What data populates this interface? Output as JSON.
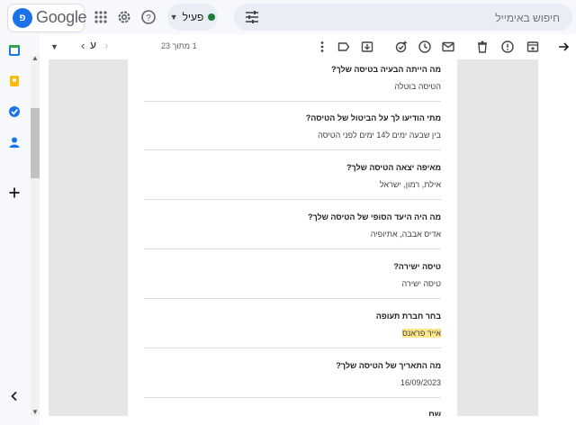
{
  "header": {
    "logo_initial": "פ",
    "logo_text": "Google",
    "status_label": "פעיל",
    "status_color": "#188038",
    "search_placeholder": "חיפוש באימייל",
    "icons": [
      "apps-grid-icon",
      "settings-gear-icon",
      "help-icon",
      "tune-icon"
    ]
  },
  "toolbar": {
    "pager_text": "1 מתוך 23",
    "lang_label": "ע",
    "icons": [
      "back-arrow-icon",
      "archive-icon",
      "report-spam-icon",
      "delete-icon",
      "mark-unread-icon",
      "snooze-icon",
      "add-task-icon",
      "move-to-icon",
      "label-icon",
      "more-vert-icon"
    ]
  },
  "rail": {
    "icons": [
      "calendar-icon",
      "keep-icon",
      "tasks-icon",
      "contacts-icon",
      "add-icon",
      "collapse-icon"
    ]
  },
  "form": {
    "items": [
      {
        "question": "מה הייתה הבעיה בטיסה שלך?",
        "answer": "הטיסה בוטלה"
      },
      {
        "question": "מתי הודיעו לך על הביטול של הטיסה?",
        "answer": "בין שבעה ימים ל14 ימים לפני הטיסה"
      },
      {
        "question": "מאיפה יצאה הטיסה שלך?",
        "answer": "אילת, רמון, ישראל"
      },
      {
        "question": "מה היה היעד הסופי של הטיסה שלך?",
        "answer": "אדיס אבבה, אתיופיה"
      },
      {
        "question": "טיסה ישירה?",
        "answer": "טיסה ישירה"
      },
      {
        "question": "בחר חברת תעופה",
        "answer": "אייר פראנס"
      },
      {
        "question": "מה התאריך של הטיסה שלך?",
        "answer": "16/09/2023"
      },
      {
        "question": "שם",
        "answer": ""
      }
    ]
  }
}
